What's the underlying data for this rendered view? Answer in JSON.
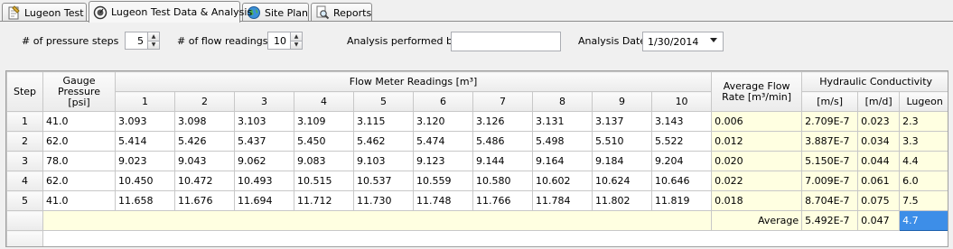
{
  "tabs": [
    {
      "label": "Lugeon Test",
      "icon": "notepad-icon"
    },
    {
      "label": "Lugeon Test Data & Analysis",
      "icon": "gauge-icon"
    },
    {
      "label": "Site Plan",
      "icon": "globe-icon"
    },
    {
      "label": "Reports",
      "icon": "magnifier-report-icon"
    }
  ],
  "controls": {
    "pressure_steps_label": "# of pressure steps",
    "pressure_steps_value": "5",
    "flow_readings_label": "# of flow readings",
    "flow_readings_value": "10",
    "analysis_by_label": "Analysis performed by",
    "analysis_by_value": "",
    "analysis_date_label": "Analysis Date",
    "analysis_date_value": "1/30/2014"
  },
  "table": {
    "headers": {
      "step": "Step",
      "gauge_pressure": "Gauge Pressure [psi]",
      "flow_readings": "Flow Meter Readings [m³]",
      "avg_flow": "Average Flow Rate [m³/min]",
      "hydraulic": "Hydraulic Conductivity",
      "reading_cols": [
        "1",
        "2",
        "3",
        "4",
        "5",
        "6",
        "7",
        "8",
        "9",
        "10"
      ],
      "hc_cols": [
        "[m/s]",
        "[m/d]",
        "Lugeon"
      ]
    },
    "rows": [
      {
        "step": "1",
        "pressure": "41.0",
        "readings": [
          "3.093",
          "3.098",
          "3.103",
          "3.109",
          "3.115",
          "3.120",
          "3.126",
          "3.131",
          "3.137",
          "3.143"
        ],
        "avg_flow": "0.006",
        "ms": "2.709E-7",
        "md": "0.023",
        "lugeon": "2.3"
      },
      {
        "step": "2",
        "pressure": "62.0",
        "readings": [
          "5.414",
          "5.426",
          "5.437",
          "5.450",
          "5.462",
          "5.474",
          "5.486",
          "5.498",
          "5.510",
          "5.522"
        ],
        "avg_flow": "0.012",
        "ms": "3.887E-7",
        "md": "0.034",
        "lugeon": "3.3"
      },
      {
        "step": "3",
        "pressure": "78.0",
        "readings": [
          "9.023",
          "9.043",
          "9.062",
          "9.083",
          "9.103",
          "9.123",
          "9.144",
          "9.164",
          "9.184",
          "9.204"
        ],
        "avg_flow": "0.020",
        "ms": "5.150E-7",
        "md": "0.044",
        "lugeon": "4.4"
      },
      {
        "step": "4",
        "pressure": "62.0",
        "readings": [
          "10.450",
          "10.472",
          "10.493",
          "10.515",
          "10.537",
          "10.559",
          "10.580",
          "10.602",
          "10.624",
          "10.646"
        ],
        "avg_flow": "0.022",
        "ms": "7.009E-7",
        "md": "0.061",
        "lugeon": "6.0"
      },
      {
        "step": "5",
        "pressure": "41.0",
        "readings": [
          "11.658",
          "11.676",
          "11.694",
          "11.712",
          "11.730",
          "11.748",
          "11.766",
          "11.784",
          "11.802",
          "11.819"
        ],
        "avg_flow": "0.018",
        "ms": "8.704E-7",
        "md": "0.075",
        "lugeon": "7.5"
      }
    ],
    "average": {
      "label": "Average",
      "ms": "5.492E-7",
      "md": "0.047",
      "lugeon": "4.7"
    }
  }
}
